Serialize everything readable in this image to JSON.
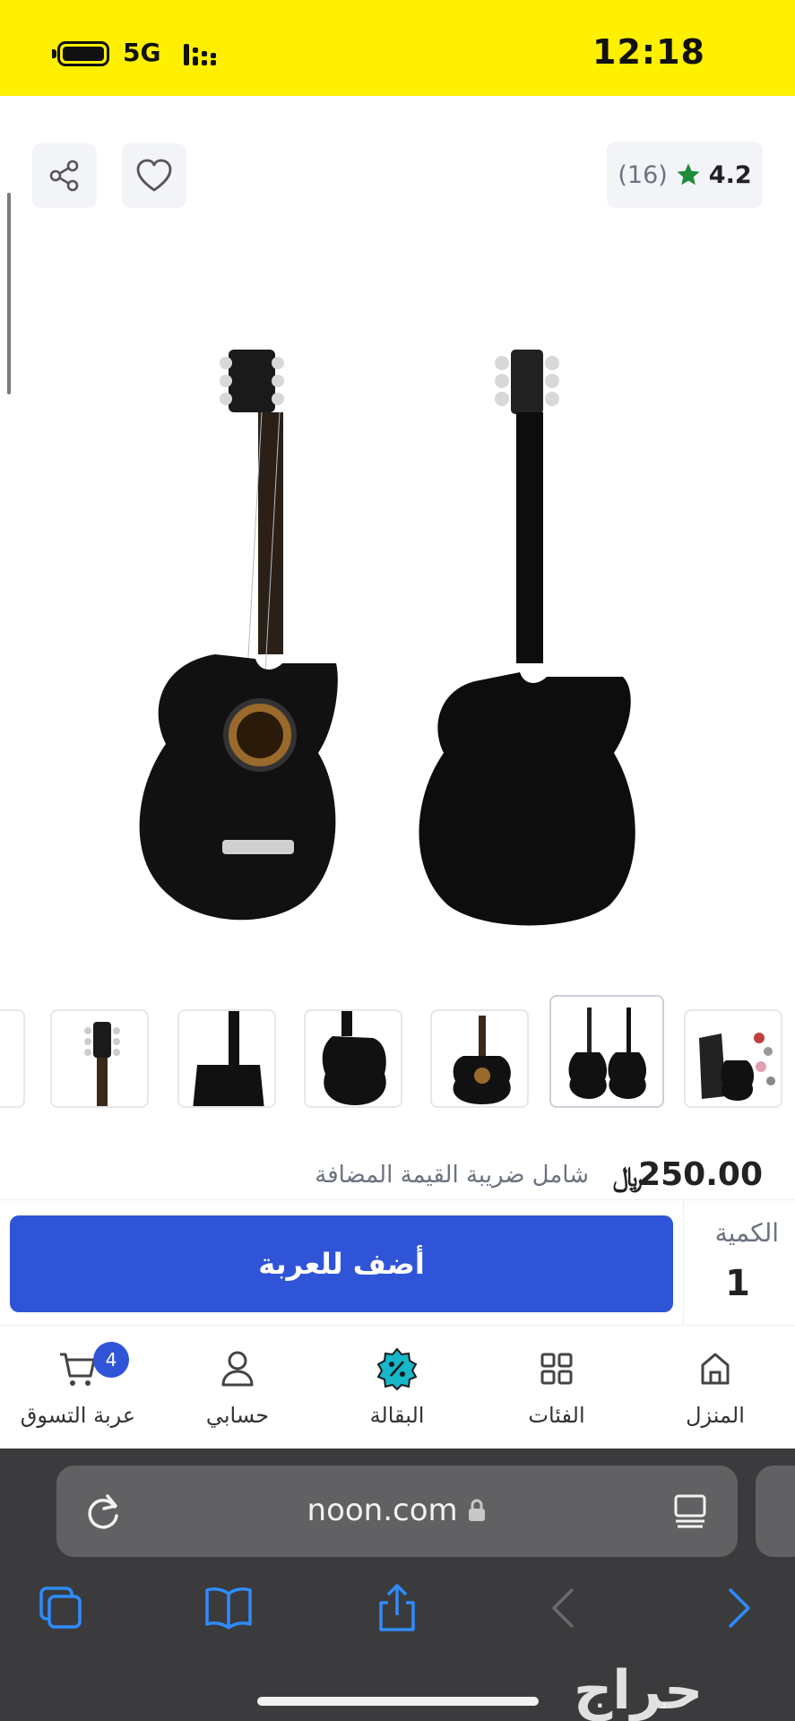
{
  "status_bar": {
    "time": "12:18",
    "network": "5G",
    "background_color": "#fef000"
  },
  "product": {
    "rating": "4.2",
    "review_count": "(16)",
    "price": "250.00",
    "currency_symbol": "﷼",
    "vat_note": "شامل ضريبة القيمة المضافة",
    "thumbnails_count": 7
  },
  "cart": {
    "quantity_label": "الكمية",
    "quantity_value": "1",
    "add_button_label": "أضف للعربة",
    "button_color": "#3054d8"
  },
  "bottom_nav": {
    "items": [
      {
        "label": "المنزل",
        "icon": "home-icon"
      },
      {
        "label": "الفئات",
        "icon": "grid-icon"
      },
      {
        "label": "البقالة",
        "icon": "percent-badge-icon"
      },
      {
        "label": "حسابي",
        "icon": "user-icon"
      },
      {
        "label": "عربة التسوق",
        "icon": "cart-icon"
      }
    ],
    "cart_badge": "4"
  },
  "browser": {
    "url": "noon.com",
    "watermark": "حراج"
  }
}
